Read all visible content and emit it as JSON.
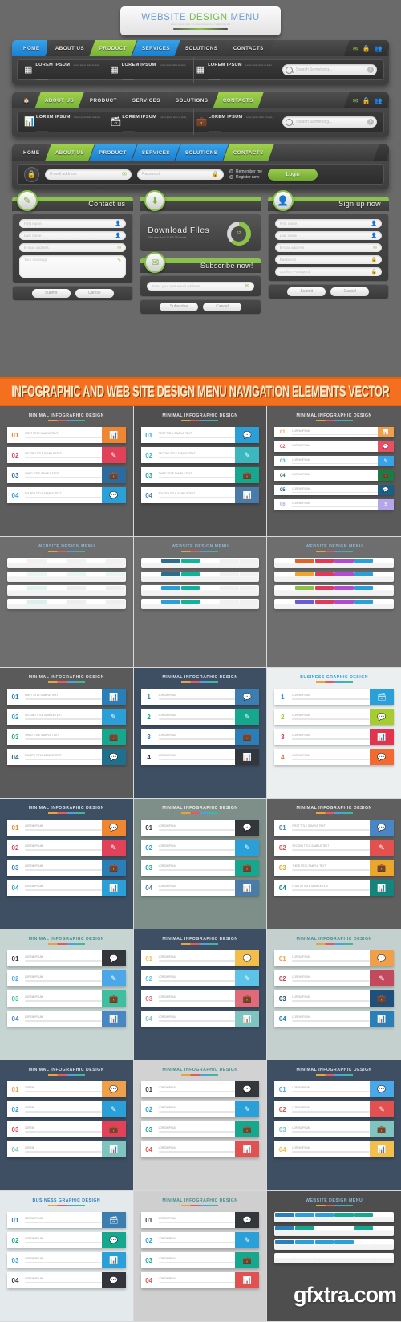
{
  "showcase": {
    "title": {
      "word1": "WEBSITE",
      "word2": "DESIGN",
      "word3": "MENU",
      "subtitle": "Lorem ipsum dolor sit amet consectetuer adipiscing elit"
    },
    "nav_items": [
      "HOME",
      "ABOUT US",
      "PRODUCT",
      "SERVICES",
      "SOLUTIONS",
      "CONTACTS"
    ],
    "nav_icons": [
      "mail-icon",
      "lock-icon",
      "users-icon"
    ],
    "features": [
      {
        "title": "LOREM IPSUM",
        "desc": "Lorem ipsum dolor sit amet, consectetuer",
        "icon": "grid-icon"
      },
      {
        "title": "LOREM IPSUM",
        "desc": "Lorem ipsum dolor sit amet, consectetuer",
        "icon": "grid-icon"
      },
      {
        "title": "LOREM IPSUM",
        "desc": "Lorem ipsum dolor sit amet, consectetuer",
        "icon": "grid-icon"
      }
    ],
    "features_row2": [
      {
        "title": "LOREM IPSUM",
        "desc": "Lorem ipsum dolor sit amet, consectetuer",
        "icon": "chart-icon"
      },
      {
        "title": "LOREM IPSUM",
        "desc": "Lorem ipsum dolor sit amet, consectetuer",
        "icon": "archive-icon"
      },
      {
        "title": "LOREM IPSUM",
        "desc": "Lorem ipsum dolor sit amet, consectetuer",
        "icon": "briefcase-icon"
      }
    ],
    "search": {
      "placeholder": "Search Something...",
      "icon": "search-icon",
      "clear": "clear-icon"
    },
    "login": {
      "email_placeholder": "E-mail address",
      "password_placeholder": "Password",
      "remember_label": "Remember me",
      "register_label": "Register now",
      "button_label": "Login",
      "lock_icon": "lock-icon"
    },
    "contact_card": {
      "heading": "Contact us",
      "badge_icon": "pencil-icon",
      "fields": [
        {
          "placeholder": "First name",
          "icon": "user-icon"
        },
        {
          "placeholder": "Last name",
          "icon": "user-icon"
        },
        {
          "placeholder": "E-mail address",
          "icon": "mail-icon"
        }
      ],
      "textarea_placeholder": "Your message",
      "textarea_icon": "pencil-icon",
      "submit_label": "Submit",
      "cancel_label": "Cancel"
    },
    "download_card": {
      "heading": "Download Files",
      "subtitle": "Files size about 20 MB ZIP format",
      "badge_icon": "download-icon",
      "progress_percent": "62"
    },
    "subscribe_card": {
      "heading": "Subscribe now!",
      "badge_icon": "mail-icon",
      "placeholder": "Enter your real email address",
      "field_icon": "mail-icon",
      "submit_label": "Subscribe",
      "cancel_label": "Cancel"
    },
    "signup_card": {
      "heading": "Sign up now",
      "badge_icon": "user-icon",
      "fields": [
        {
          "placeholder": "First name",
          "icon": "user-icon"
        },
        {
          "placeholder": "Last name",
          "icon": "user-icon"
        },
        {
          "placeholder": "E-mail address",
          "icon": "mail-icon"
        },
        {
          "placeholder": "Password",
          "icon": "lock-icon"
        },
        {
          "placeholder": "Confirm Password",
          "icon": "lock-icon"
        }
      ],
      "submit_label": "Submit",
      "cancel_label": "Cancel"
    }
  },
  "banner": {
    "text": "INFOGRAPHIC AND WEB SITE DESIGN MENU NAVIGATION ELEMENTS VECTOR",
    "bg_color": "#f4701f",
    "text_color": "#ffe9c9"
  },
  "thumbnails": [
    {
      "title": "MINIMAL INFOGRAPHIC DESIGN",
      "bg": "#5d5d5d",
      "title_color": "#e4e4e4",
      "items": [
        {
          "num": "01",
          "text": "FIRST TITLE SAMPLE TEXT",
          "color": "#f0862f",
          "icon": "chart-icon"
        },
        {
          "num": "02",
          "text": "SECOND TITLE SAMPLE TEXT",
          "color": "#e2415a",
          "icon": "pencil-icon"
        },
        {
          "num": "03",
          "text": "THIRD TITLE SAMPLE TEXT",
          "color": "#2d6b9e",
          "icon": "briefcase-icon"
        },
        {
          "num": "04",
          "text": "FOURTH TITLE SAMPLE TEXT",
          "color": "#2a9fd8",
          "icon": "chat-icon"
        }
      ]
    },
    {
      "title": "MINIMAL INFOGRAPHIC DESIGN",
      "bg": "#4f4f4f",
      "title_color": "#e4e4e4",
      "items": [
        {
          "num": "01",
          "text": "FIRST TITLE SAMPLE TEXT",
          "color": "#2a9fd8",
          "icon": "chat-icon"
        },
        {
          "num": "02",
          "text": "SECOND TITLE SAMPLE TEXT",
          "color": "#3ab7bf",
          "icon": "pencil-icon"
        },
        {
          "num": "03",
          "text": "THIRD TITLE SAMPLE TEXT",
          "color": "#15a88e",
          "icon": "briefcase-icon"
        },
        {
          "num": "04",
          "text": "FOURTH TITLE SAMPLE TEXT",
          "color": "#4b7ba8",
          "icon": "chart-icon"
        }
      ]
    },
    {
      "title": "MINIMAL INFOGRAPHIC DESIGN",
      "bg": "#5a5a5a",
      "title_color": "#e8e8e8",
      "items": [
        {
          "num": "01",
          "text": "LOREM IPSUM",
          "color": "#f0a04b",
          "icon": "chart-icon"
        },
        {
          "num": "02",
          "text": "LOREM IPSUM",
          "color": "#e94f64",
          "icon": "chat-icon"
        },
        {
          "num": "03",
          "text": "LOREM IPSUM",
          "color": "#3aa3e8",
          "icon": "pencil-icon"
        },
        {
          "num": "04",
          "text": "LOREM IPSUM",
          "color": "#1d7a42",
          "icon": "briefcase-icon"
        },
        {
          "num": "05",
          "text": "LOREM IPSUM",
          "color": "#1a5f87",
          "icon": "chat-icon"
        },
        {
          "num": "06",
          "text": "LOREM IPSUM",
          "color": "#b4a6e8",
          "icon": "dollar-icon"
        }
      ]
    },
    {
      "title": "WEBSITE DESIGN MENU",
      "bg": "#6e6e6e",
      "title_color": "#8fb8d8",
      "menus": [
        {
          "colors": [
            "#ffffff",
            "#f1f1f1",
            "#ffffff",
            "#f1f1f1",
            "#ffffff",
            "#f1f1f1"
          ]
        },
        {
          "colors": [
            "#ffffff",
            "#e8f6f4",
            "#ffffff",
            "#e8f6f4",
            "#ffffff",
            "#e8f6f4"
          ]
        },
        {
          "colors": [
            "#ffffff",
            "#dff3ef",
            "#ffffff",
            "#eeeeee",
            "#ffffff",
            "#eeeeee"
          ]
        },
        {
          "colors": [
            "#ffffff",
            "#d9f0ec",
            "#ffffff",
            "#eeeeee",
            "#ffffff",
            "#eeeeee"
          ]
        }
      ]
    },
    {
      "title": "WEBSITE DESIGN MENU",
      "bg": "#6e6e6e",
      "title_color": "#8fb8d8",
      "menus": [
        {
          "colors": [
            "#ffffff",
            "#2f6d8f",
            "#12b39a",
            "#ffffff",
            "#f1f1f1",
            "#f1f1f1"
          ]
        },
        {
          "colors": [
            "#ffffff",
            "#2f6d8f",
            "#12b39a",
            "#ffffff",
            "#f1f1f1",
            "#f1f1f1"
          ]
        },
        {
          "colors": [
            "#ffffff",
            "#2a9fd8",
            "#12b39a",
            "#ffffff",
            "#f1f1f1",
            "#f1f1f1"
          ]
        },
        {
          "colors": [
            "#ffffff",
            "#2a9fd8",
            "#12b39a",
            "#ffffff",
            "#f1f1f1",
            "#f1f1f1"
          ]
        }
      ]
    },
    {
      "title": "WEBSITE DESIGN MENU",
      "bg": "#6e6e6e",
      "title_color": "#8fb8d8",
      "menus": [
        {
          "colors": [
            "#ffffff",
            "#e0622f",
            "#e03a5a",
            "#b14bd0",
            "#2a9fd8",
            "#ffffff"
          ]
        },
        {
          "colors": [
            "#ffffff",
            "#f0a52f",
            "#e03a5a",
            "#b14bd0",
            "#2a9fd8",
            "#ffffff"
          ]
        },
        {
          "colors": [
            "#ffffff",
            "#8ac24a",
            "#e03a5a",
            "#b14bd0",
            "#2a9fd8",
            "#ffffff"
          ]
        },
        {
          "colors": [
            "#ffffff",
            "#6b5bd0",
            "#e03a5a",
            "#b14bd0",
            "#2a9fd8",
            "#ffffff"
          ]
        }
      ]
    },
    {
      "title": "MINIMAL INFOGRAPHIC DESIGN",
      "bg": "#5a5a5a",
      "title_color": "#e0e0e0",
      "items": [
        {
          "num": "01",
          "text": "FIRST TITLE SAMPLE TEXT",
          "color": "#2a7fb8",
          "icon": "chart-icon"
        },
        {
          "num": "02",
          "text": "SECOND TITLE SAMPLE TEXT",
          "color": "#2a9fd8",
          "icon": "pencil-icon"
        },
        {
          "num": "03",
          "text": "THIRD TITLE SAMPLE TEXT",
          "color": "#15a88e",
          "icon": "briefcase-icon"
        },
        {
          "num": "04",
          "text": "FOURTH TITLE SAMPLE TEXT",
          "color": "#1f6f8f",
          "icon": "chat-icon"
        }
      ]
    },
    {
      "title": "MINIMAL INFOGRAPHIC DESIGN",
      "bg": "#3e4f63",
      "title_color": "#d8e2ea",
      "items": [
        {
          "num": "1",
          "text": "LOREM IPSUM",
          "color": "#3d7eb0",
          "icon": "chat-icon"
        },
        {
          "num": "2",
          "text": "LOREM IPSUM",
          "color": "#15a88e",
          "icon": "pencil-icon"
        },
        {
          "num": "3",
          "text": "LOREM IPSUM",
          "color": "#2a7fb8",
          "icon": "briefcase-icon"
        },
        {
          "num": "4",
          "text": "LOREM IPSUM",
          "color": "#33363a",
          "icon": "chart-icon"
        }
      ]
    },
    {
      "title": "BUSINESS GRAPHIC DESIGN",
      "bg": "#eceff0",
      "title_color": "#2a9fd8",
      "items": [
        {
          "num": "1",
          "text": "LOREM IPSUM",
          "color": "#2a9fd8",
          "icon": "archive-icon"
        },
        {
          "num": "2",
          "text": "LOREM IPSUM",
          "color": "#a7cc30",
          "icon": "chat-icon"
        },
        {
          "num": "3",
          "text": "LOREM IPSUM",
          "color": "#e2334f",
          "icon": "chart-icon"
        },
        {
          "num": "4",
          "text": "LOREM IPSUM",
          "color": "#f26a31",
          "icon": "chat-icon"
        }
      ]
    },
    {
      "title": "MINIMAL INFOGRAPHIC DESIGN",
      "bg": "#3e4f63",
      "title_color": "#d8e2ea",
      "items": [
        {
          "num": "01",
          "text": "LOREM IPSUM",
          "color": "#f0862f",
          "icon": "chat-icon"
        },
        {
          "num": "02",
          "text": "LOREM IPSUM",
          "color": "#e2415a",
          "icon": "pencil-icon"
        },
        {
          "num": "03",
          "text": "LOREM IPSUM",
          "color": "#2a7fb8",
          "icon": "briefcase-icon"
        },
        {
          "num": "04",
          "text": "LOREM IPSUM",
          "color": "#2a9fd8",
          "icon": "chart-icon"
        }
      ]
    },
    {
      "title": "MINIMAL INFOGRAPHIC DESIGN",
      "bg": "#7d8f88",
      "title_color": "#eeeeee",
      "items": [
        {
          "num": "01",
          "text": "LOREM IPSUM",
          "color": "#33363a",
          "icon": "chat-icon"
        },
        {
          "num": "02",
          "text": "LOREM IPSUM",
          "color": "#2a9fd8",
          "icon": "pencil-icon"
        },
        {
          "num": "03",
          "text": "LOREM IPSUM",
          "color": "#15a88e",
          "icon": "briefcase-icon"
        },
        {
          "num": "04",
          "text": "LOREM IPSUM",
          "color": "#4b7ba8",
          "icon": "chart-icon"
        }
      ]
    },
    {
      "title": "MINIMAL INFOGRAPHIC DESIGN",
      "bg": "#5f5f5f",
      "title_color": "#e8e8e8",
      "items": [
        {
          "num": "01",
          "text": "FIRST TITLE SAMPLE TEXT",
          "color": "#4b86c4",
          "icon": "chat-icon"
        },
        {
          "num": "02",
          "text": "SECOND TITLE SAMPLE TEXT",
          "color": "#e2504f",
          "icon": "pencil-icon"
        },
        {
          "num": "03",
          "text": "THIRD TITLE SAMPLE TEXT",
          "color": "#eaa72b",
          "icon": "briefcase-icon"
        },
        {
          "num": "04",
          "text": "FOURTH TITLE SAMPLE TEXT",
          "color": "#13857c",
          "icon": "chart-icon"
        }
      ]
    },
    {
      "title": "MINIMAL INFOGRAPHIC DESIGN",
      "bg": "#c7d5d2",
      "title_color": "#3f8f8a",
      "items": [
        {
          "num": "01",
          "text": "LOREM IPSUM",
          "color": "#33363a",
          "icon": "chat-icon"
        },
        {
          "num": "02",
          "text": "LOREM IPSUM",
          "color": "#4aa8e8",
          "icon": "pencil-icon"
        },
        {
          "num": "03",
          "text": "LOREM IPSUM",
          "color": "#3fbfa0",
          "icon": "briefcase-icon"
        },
        {
          "num": "04",
          "text": "LOREM IPSUM",
          "color": "#4b86c4",
          "icon": "chart-icon"
        }
      ]
    },
    {
      "title": "MINIMAL INFOGRAPHIC DESIGN",
      "bg": "#3e4f63",
      "title_color": "#d8e2ea",
      "items": [
        {
          "num": "01",
          "text": "LOREM IPSUM",
          "color": "#f3bf4a",
          "icon": "chat-icon"
        },
        {
          "num": "02",
          "text": "LOREM IPSUM",
          "color": "#5bc4e8",
          "icon": "pencil-icon"
        },
        {
          "num": "03",
          "text": "LOREM IPSUM",
          "color": "#e2697a",
          "icon": "briefcase-icon"
        },
        {
          "num": "04",
          "text": "LOREM IPSUM",
          "color": "#7fc4bf",
          "icon": "chart-icon"
        }
      ]
    },
    {
      "title": "MINIMAL INFOGRAPHIC DESIGN",
      "bg": "#c3d0ce",
      "title_color": "#3f8f8a",
      "items": [
        {
          "num": "01",
          "text": "LOREM IPSUM",
          "color": "#f0a04b",
          "icon": "chat-icon"
        },
        {
          "num": "02",
          "text": "LOREM IPSUM",
          "color": "#c24a5c",
          "icon": "pencil-icon"
        },
        {
          "num": "03",
          "text": "LOREM IPSUM",
          "color": "#1f4f7a",
          "icon": "briefcase-icon"
        },
        {
          "num": "04",
          "text": "LOREM IPSUM",
          "color": "#2a7fb8",
          "icon": "chart-icon"
        }
      ]
    },
    {
      "title": "MINIMAL INFOGRAPHIC DESIGN",
      "bg": "#3e4f63",
      "title_color": "#d8e2ea",
      "items": [
        {
          "num": "01",
          "text": "LOREM",
          "color": "#f0a04b",
          "icon": "chat-icon"
        },
        {
          "num": "02",
          "text": "LOREM",
          "color": "#2a9fd8",
          "icon": "pencil-icon"
        },
        {
          "num": "03",
          "text": "LOREM",
          "color": "#e2415a",
          "icon": "briefcase-icon"
        },
        {
          "num": "04",
          "text": "LOREM",
          "color": "#7fc4bf",
          "icon": "chart-icon"
        }
      ]
    },
    {
      "title": "MINIMAL INFOGRAPHIC DESIGN",
      "bg": "#d2d2d2",
      "title_color": "#3f8f8a",
      "items": [
        {
          "num": "01",
          "text": "LOREM IPSUM",
          "color": "#33363a",
          "icon": "chat-icon"
        },
        {
          "num": "02",
          "text": "LOREM IPSUM",
          "color": "#2a9fd8",
          "icon": "pencil-icon"
        },
        {
          "num": "03",
          "text": "LOREM IPSUM",
          "color": "#15a88e",
          "icon": "briefcase-icon"
        },
        {
          "num": "04",
          "text": "LOREM IPSUM",
          "color": "#e2504f",
          "icon": "chart-icon"
        }
      ]
    },
    {
      "title": "MINIMAL INFOGRAPHIC DESIGN",
      "bg": "#3e4f63",
      "title_color": "#d8e2ea",
      "items": [
        {
          "num": "01",
          "text": "LOREM IPSUM",
          "color": "#4aa8e8",
          "icon": "chat-icon"
        },
        {
          "num": "02",
          "text": "LOREM IPSUM",
          "color": "#e2504f",
          "icon": "pencil-icon"
        },
        {
          "num": "03",
          "text": "LOREM IPSUM",
          "color": "#7fc4bf",
          "icon": "briefcase-icon"
        },
        {
          "num": "04",
          "text": "LOREM IPSUM",
          "color": "#f3bf4a",
          "icon": "chart-icon"
        }
      ]
    },
    {
      "title": "BUSINESS GRAPHIC DESIGN",
      "bg": "#e4eaec",
      "title_color": "#2a7fb8",
      "items": [
        {
          "num": "01",
          "text": "LOREM IPSUM",
          "color": "#3d7eb0",
          "icon": "archive-icon"
        },
        {
          "num": "02",
          "text": "LOREM IPSUM",
          "color": "#15a88e",
          "icon": "chat-icon"
        },
        {
          "num": "03",
          "text": "LOREM IPSUM",
          "color": "#2a9fd8",
          "icon": "chart-icon"
        },
        {
          "num": "04",
          "text": "LOREM IPSUM",
          "color": "#33363a",
          "icon": "chat-icon"
        }
      ]
    },
    {
      "title": "MINIMAL INFOGRAPHIC DESIGN",
      "bg": "#cfcfcf",
      "title_color": "#3f8f8a",
      "items": [
        {
          "num": "01",
          "text": "LOREM IPSUM",
          "color": "#33363a",
          "icon": "chat-icon"
        },
        {
          "num": "02",
          "text": "LOREM IPSUM",
          "color": "#2a9fd8",
          "icon": "pencil-icon"
        },
        {
          "num": "03",
          "text": "LOREM IPSUM",
          "color": "#15a88e",
          "icon": "briefcase-icon"
        },
        {
          "num": "04",
          "text": "LOREM IPSUM",
          "color": "#e2504f",
          "icon": "chart-icon"
        }
      ]
    },
    {
      "title": "WEBSITE DESIGN MENU",
      "bg": "#4e4e4e",
      "title_color": "#8fb8d8",
      "menus": [
        {
          "colors": [
            "#2a7fb8",
            "#2a9fd8",
            "#2a9fd8",
            "#15a88e",
            "#15a88e",
            "#ffffff"
          ]
        },
        {
          "colors": [
            "#2a7fb8",
            "#15a88e",
            "#ffffff",
            "#ffffff",
            "#15a88e",
            "#ffffff"
          ]
        },
        {
          "colors": [
            "#2a7fb8",
            "#2a9fd8",
            "#2a9fd8",
            "#2a9fd8",
            "#ffffff",
            "#ffffff"
          ]
        },
        {
          "colors": [
            "#ffffff",
            "#ffffff",
            "#ffffff",
            "#ffffff",
            "#ffffff",
            "#ffffff"
          ]
        }
      ],
      "watermark": "gfxtra.com"
    }
  ]
}
